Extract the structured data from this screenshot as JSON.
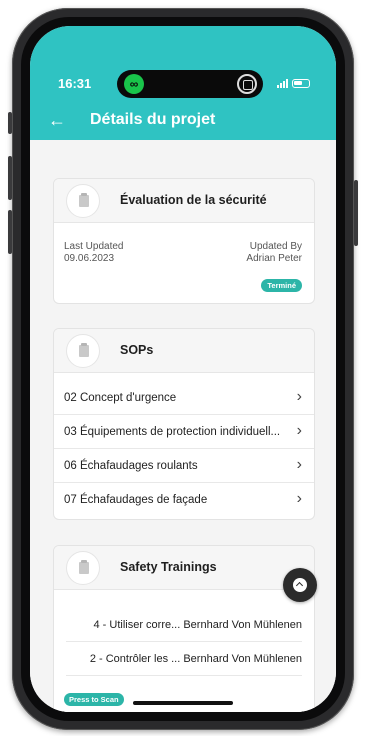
{
  "status_bar": {
    "time": "16:31"
  },
  "header": {
    "title": "Détails du projet"
  },
  "safety_card": {
    "title": "Évaluation de la sécurité",
    "last_updated_label": "Last Updated",
    "last_updated_value": "09.06.2023",
    "updated_by_label": "Updated By",
    "updated_by_value": "Adrian Peter",
    "status_badge": "Terminé"
  },
  "sops_card": {
    "title": "SOPs",
    "items": [
      {
        "label": "02 Concept d'urgence"
      },
      {
        "label": "03 Équipements de protection individuell..."
      },
      {
        "label": "06 Échafaudages roulants"
      },
      {
        "label": "07 Échafaudages de façade"
      }
    ]
  },
  "trainings_card": {
    "title": "Safety Trainings",
    "items": [
      {
        "label": "4 - Utiliser corre... Bernhard Von Mühlenen"
      },
      {
        "label": "2 - Contrôler les ... Bernhard Von Mühlenen"
      }
    ],
    "scan_badge": "Press to Scan"
  },
  "icons": {
    "back": "arrow-left-icon",
    "chevron": "chevron-right-icon",
    "fab": "scroll-up-icon",
    "card": "clipboard-icon"
  },
  "colors": {
    "header": "#2fc3c2",
    "badge": "#2cb5a8"
  }
}
